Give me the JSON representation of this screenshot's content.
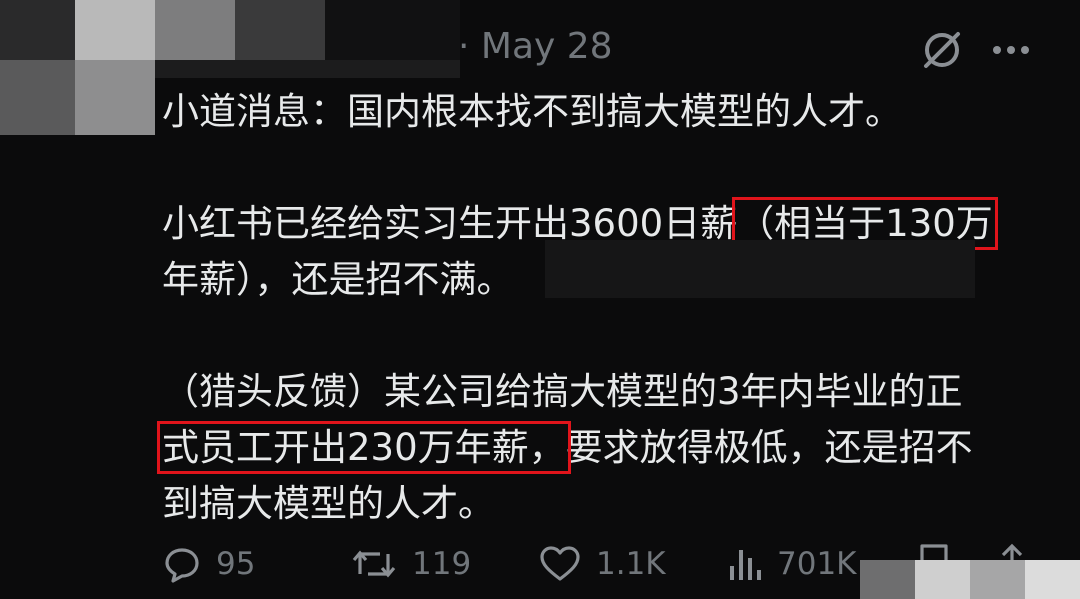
{
  "header": {
    "separator": "·",
    "date": "May 28",
    "grok_icon": "grok-slash-circle-icon",
    "more_icon": "more-horizontal-icon"
  },
  "post": {
    "line1": "小道消息：国内根本找不到搞大模型的人才。",
    "para2_prefix": "小红书已经给实习生开出3600日薪",
    "para2_highlight_a": "（相当于130万",
    "para2_highlight_b": "年薪）",
    "para2_suffix": "，还是招不满。",
    "para3_line1": "（猎头反馈）某公司给搞大模型的3年内毕业的正",
    "para3_highlight": "式员工开出230万年薪，",
    "para3_line2_rest": "要求放得极低，还是招不",
    "para3_line3": "到搞大模型的人才。"
  },
  "actions": {
    "reply_count": "95",
    "repost_count": "119",
    "like_count": "1.1K",
    "views_count": "701K"
  },
  "colors": {
    "background": "#0b0b0c",
    "text": "#e7e9ea",
    "muted": "#71767b",
    "highlight_box": "#e0141b"
  }
}
